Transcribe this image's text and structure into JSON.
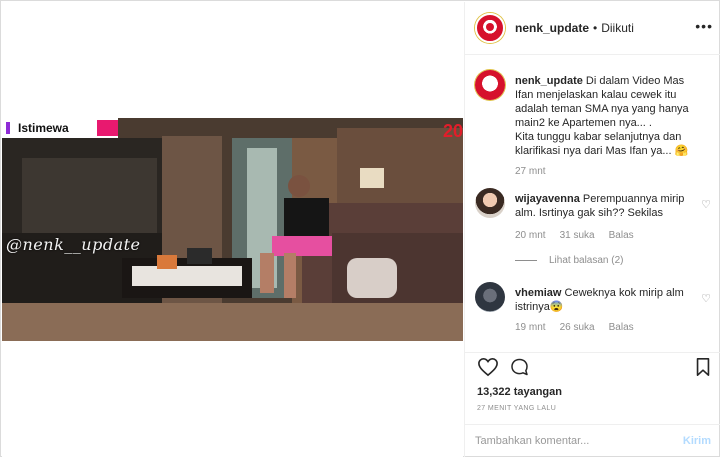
{
  "media": {
    "tag_label": "Istimewa",
    "watermark": "@nenk__update",
    "corner_logo": "20"
  },
  "header": {
    "username": "nenk_update",
    "separator": "•",
    "follow_status": "Diikuti",
    "more_icon": "more-horizontal-icon"
  },
  "caption": {
    "username": "nenk_update",
    "text": "Di dalam Video Mas Ifan menjelaskan kalau cewek itu adalah teman SMA nya yang hanya main2 ke Apartemen nya... .",
    "text2": "Kita tunggu kabar selanjutnya dan klarifikasi nya dari Mas Ifan ya... 🤗",
    "time": "27 mnt"
  },
  "comments": [
    {
      "username": "wijayavenna",
      "text": "Perempuannya mirip alm. Isrtinya gak sih?? Sekilas",
      "time": "20 mnt",
      "likes": "31 suka",
      "reply": "Balas",
      "view_replies": "Lihat balasan (2)"
    },
    {
      "username": "vhemiaw",
      "text": "Ceweknya kok mirip alm istrinya😨",
      "time": "19 mnt",
      "likes": "26 suka",
      "reply": "Balas"
    }
  ],
  "actions": {
    "like_icon": "heart-outline-icon",
    "comment_icon": "comment-bubble-icon",
    "save_icon": "bookmark-icon",
    "views": "13,322 tayangan",
    "posted": "27 MENIT YANG LALU"
  },
  "composer": {
    "placeholder": "Tambahkan komentar...",
    "value": "",
    "post_label": "Kirim"
  },
  "colors": {
    "border": "#dbdbdb",
    "muted": "#8e8e8e",
    "post_disabled": "#b3dbff",
    "tag_accent": "#e8196f"
  }
}
